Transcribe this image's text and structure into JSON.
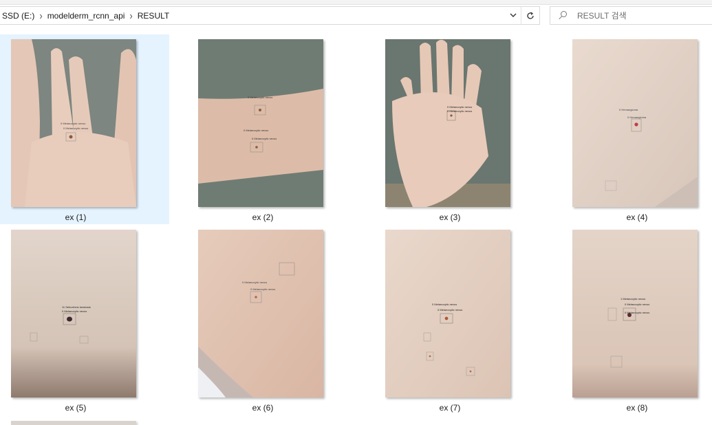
{
  "address": {
    "segments": [
      "SSD (E:)",
      "modelderm_rcnn_api",
      "RESULT"
    ],
    "dropdown_icon": "chevron-down-icon",
    "refresh_icon": "refresh-icon"
  },
  "search": {
    "placeholder": "RESULT 검색",
    "icon": "search-icon"
  },
  "files": [
    {
      "name": "ex (1)",
      "selected": true
    },
    {
      "name": "ex (2)",
      "selected": false
    },
    {
      "name": "ex (3)",
      "selected": false
    },
    {
      "name": "ex (4)",
      "selected": false
    },
    {
      "name": "ex (5)",
      "selected": false
    },
    {
      "name": "ex (6)",
      "selected": false
    },
    {
      "name": "ex (7)",
      "selected": false
    },
    {
      "name": "ex (8)",
      "selected": false
    }
  ],
  "colors": {
    "selection": "#e5f3ff",
    "border": "#d9d9d9",
    "skin": "#e8d7cb"
  }
}
